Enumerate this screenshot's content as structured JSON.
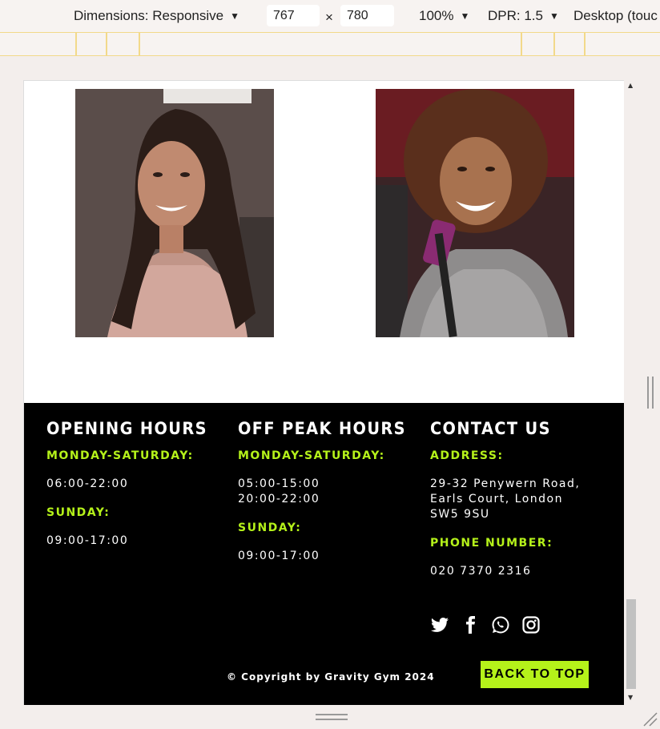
{
  "devtools": {
    "dimensions_label": "Dimensions: Responsive",
    "width_value": "767",
    "times": "×",
    "height_value": "780",
    "zoom": "100%",
    "dpr": "DPR: 1.5",
    "mode": "Desktop (touc"
  },
  "photos": [
    {
      "name": "trainer-photo-1",
      "icon": "person-photo"
    },
    {
      "name": "trainer-photo-2",
      "icon": "person-photo"
    }
  ],
  "footer": {
    "opening": {
      "title": "OPENING HOURS",
      "weekday_label": "MONDAY-SATURDAY:",
      "weekday_hours": "06:00-22:00",
      "sunday_label": "SUNDAY:",
      "sunday_hours": "09:00-17:00"
    },
    "offpeak": {
      "title": "OFF PEAK HOURS",
      "weekday_label": "MONDAY-SATURDAY:",
      "weekday_hours_1": "05:00-15:00",
      "weekday_hours_2": "20:00-22:00",
      "sunday_label": "SUNDAY:",
      "sunday_hours": "09:00-17:00"
    },
    "contact": {
      "title": "CONTACT US",
      "address_label": "ADDRESS:",
      "address_line1": "29-32 Penywern Road,",
      "address_line2": "Earls Court, London",
      "address_line3": "SW5 9SU",
      "phone_label": "PHONE NUMBER:",
      "phone": "020 7370 2316"
    },
    "socials": [
      "twitter-icon",
      "facebook-icon",
      "whatsapp-icon",
      "instagram-icon"
    ],
    "copyright": "© Copyright by Gravity Gym 2024",
    "back_to_top": "BACK TO TOP"
  },
  "colors": {
    "accent": "#b5f21a",
    "footer_bg": "#000000"
  }
}
